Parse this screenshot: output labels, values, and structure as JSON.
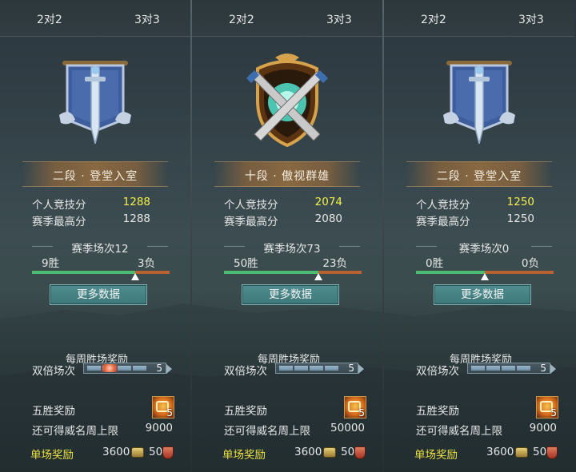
{
  "panels": [
    {
      "tabs": {
        "twoVtwo": "2对2",
        "threeVthree": "3对3"
      },
      "emblem": "banner-sword-emblem-icon",
      "rank": "二段 · 登堂入室",
      "personal_score_label": "个人竞技分",
      "personal_score": "1288",
      "season_high_label": "赛季最高分",
      "season_high": "1288",
      "season_matches": "赛季场次12",
      "wins": "9胜",
      "losses": "3负",
      "win_fraction": 0.75,
      "more_data": "更多数据",
      "weekly_title": "每周胜场奖励",
      "double_label": "双倍场次",
      "double_count": "5",
      "five_win_label": "五胜奖励",
      "five_win_count": "5",
      "limit_label": "还可得威名周上限",
      "limit_value": "9000",
      "single_label": "单场奖励",
      "coin_value": "3600",
      "shield_value": "50"
    },
    {
      "tabs": {
        "twoVtwo": "2对2",
        "threeVthree": "3对3"
      },
      "emblem": "crossed-swords-emblem-icon",
      "rank": "十段 · 傲视群雄",
      "personal_score_label": "个人竞技分",
      "personal_score": "2074",
      "season_high_label": "赛季最高分",
      "season_high": "2080",
      "season_matches": "赛季场次73",
      "wins": "50胜",
      "losses": "23负",
      "win_fraction": 0.685,
      "more_data": "更多数据",
      "weekly_title": "每周胜场奖励",
      "double_label": "双倍场次",
      "double_count": "5",
      "five_win_label": "五胜奖励",
      "five_win_count": "5",
      "limit_label": "还可得威名周上限",
      "limit_value": "50000",
      "single_label": "单场奖励",
      "coin_value": "3600",
      "shield_value": "50"
    },
    {
      "tabs": {
        "twoVtwo": "2对2",
        "threeVthree": "3对3"
      },
      "emblem": "banner-sword-emblem-icon",
      "rank": "二段 · 登堂入室",
      "personal_score_label": "个人竞技分",
      "personal_score": "1250",
      "season_high_label": "赛季最高分",
      "season_high": "1250",
      "season_matches": "赛季场次0",
      "wins": "0胜",
      "losses": "0负",
      "win_fraction": 0.5,
      "more_data": "更多数据",
      "weekly_title": "每周胜场奖励",
      "double_label": "双倍场次",
      "double_count": "5",
      "five_win_label": "五胜奖励",
      "five_win_count": "5",
      "limit_label": "还可得威名周上限",
      "limit_value": "9000",
      "single_label": "单场奖励",
      "coin_value": "3600",
      "shield_value": "50"
    }
  ],
  "colors": {
    "highlight_score": "#f4f04a",
    "win_bar": "#4dbb74",
    "loss_bar": "#b56230",
    "single_reward_label": "#e8e040"
  }
}
